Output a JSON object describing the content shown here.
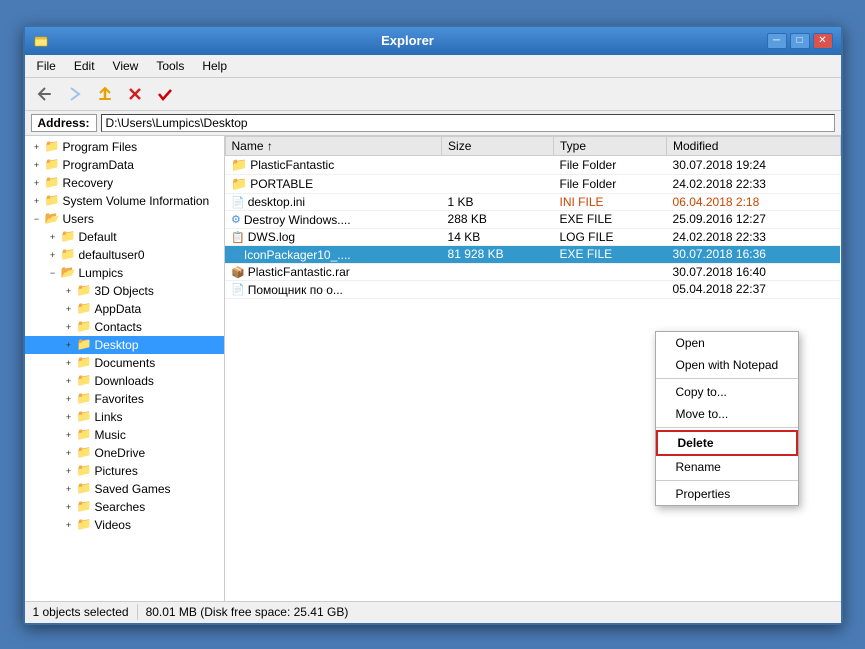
{
  "window": {
    "title": "Explorer",
    "title_icon": "folder",
    "buttons": {
      "minimize": "─",
      "restore": "□",
      "close": "✕"
    }
  },
  "menu": {
    "items": [
      "File",
      "Edit",
      "View",
      "Tools",
      "Help"
    ]
  },
  "toolbar": {
    "buttons": [
      "back",
      "forward",
      "up",
      "delete",
      "checkmark"
    ]
  },
  "address": {
    "label": "Address:",
    "value": "D:\\Users\\Lumpics\\Desktop"
  },
  "tree": {
    "items": [
      {
        "label": "Program Files",
        "indent": 1,
        "expanded": false
      },
      {
        "label": "ProgramData",
        "indent": 1,
        "expanded": false
      },
      {
        "label": "Recovery",
        "indent": 1,
        "expanded": false
      },
      {
        "label": "System Volume Information",
        "indent": 1,
        "expanded": false
      },
      {
        "label": "Users",
        "indent": 1,
        "expanded": true
      },
      {
        "label": "Default",
        "indent": 2,
        "expanded": false
      },
      {
        "label": "defaultuser0",
        "indent": 2,
        "expanded": false
      },
      {
        "label": "Lumpics",
        "indent": 2,
        "expanded": true
      },
      {
        "label": "3D Objects",
        "indent": 3,
        "expanded": false
      },
      {
        "label": "AppData",
        "indent": 3,
        "expanded": false
      },
      {
        "label": "Contacts",
        "indent": 3,
        "expanded": false
      },
      {
        "label": "Desktop",
        "indent": 3,
        "expanded": false,
        "selected": true
      },
      {
        "label": "Documents",
        "indent": 3,
        "expanded": false
      },
      {
        "label": "Downloads",
        "indent": 3,
        "expanded": false
      },
      {
        "label": "Favorites",
        "indent": 3,
        "expanded": false
      },
      {
        "label": "Links",
        "indent": 3,
        "expanded": false
      },
      {
        "label": "Music",
        "indent": 3,
        "expanded": false
      },
      {
        "label": "OneDrive",
        "indent": 3,
        "expanded": false
      },
      {
        "label": "Pictures",
        "indent": 3,
        "expanded": false
      },
      {
        "label": "Saved Games",
        "indent": 3,
        "expanded": false
      },
      {
        "label": "Searches",
        "indent": 3,
        "expanded": false
      },
      {
        "label": "Videos",
        "indent": 3,
        "expanded": false
      }
    ]
  },
  "files": {
    "columns": [
      "Name",
      "Size",
      "Type",
      "Modified"
    ],
    "rows": [
      {
        "name": "PlasticFantastic",
        "size": "",
        "type": "File Folder",
        "modified": "30.07.2018 19:24",
        "icon": "folder"
      },
      {
        "name": "PORTABLE",
        "size": "",
        "type": "File Folder",
        "modified": "24.02.2018 22:33",
        "icon": "folder"
      },
      {
        "name": "desktop.ini",
        "size": "1 KB",
        "type": "INI FILE",
        "modified": "06.04.2018 2:18",
        "icon": "file"
      },
      {
        "name": "Destroy Windows....",
        "size": "288 KB",
        "type": "EXE FILE",
        "modified": "25.09.2016 12:27",
        "icon": "exe"
      },
      {
        "name": "DWS.log",
        "size": "14 KB",
        "type": "LOG FILE",
        "modified": "24.02.2018 22:33",
        "icon": "file"
      },
      {
        "name": "IconPackager10_....",
        "size": "81 928 KB",
        "type": "EXE FILE",
        "modified": "30.07.2018 16:36",
        "icon": "exe",
        "selected": true
      },
      {
        "name": "PlasticFantastic.rar",
        "size": "",
        "type": "",
        "modified": "30.07.2018 16:40",
        "icon": "file"
      },
      {
        "name": "Помощник по о...",
        "size": "",
        "type": "",
        "modified": "05.04.2018 22:37",
        "icon": "file"
      }
    ]
  },
  "context_menu": {
    "items": [
      {
        "label": "Open",
        "type": "item"
      },
      {
        "label": "Open with Notepad",
        "type": "item"
      },
      {
        "label": "",
        "type": "separator"
      },
      {
        "label": "Copy to...",
        "type": "item"
      },
      {
        "label": "Move to...",
        "type": "item"
      },
      {
        "label": "",
        "type": "separator"
      },
      {
        "label": "Delete",
        "type": "item",
        "highlighted": true
      },
      {
        "label": "Rename",
        "type": "item"
      },
      {
        "label": "",
        "type": "separator"
      },
      {
        "label": "Properties",
        "type": "item"
      }
    ]
  },
  "status_bar": {
    "objects_selected": "1 objects selected",
    "disk_info": "80.01 MB (Disk free space: 25.41 GB)"
  }
}
